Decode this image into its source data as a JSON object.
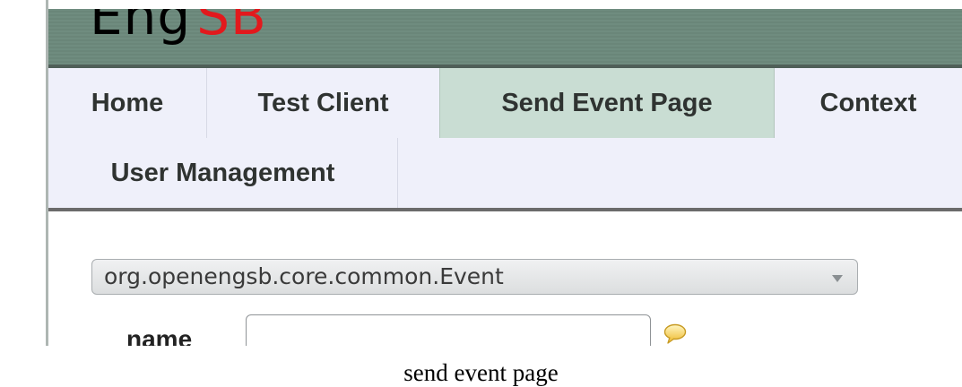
{
  "header": {
    "logo_primary": "Eng",
    "logo_accent": "SB",
    "colors": {
      "bar": "#6f8c7f",
      "logo_accent": "#e2191d"
    }
  },
  "nav": {
    "tabs": [
      {
        "label": "Home"
      },
      {
        "label": "Test Client"
      },
      {
        "label": "Send Event Page",
        "active": true
      },
      {
        "label": "Context"
      },
      {
        "label": "User Management"
      }
    ],
    "colors": {
      "background": "#eff0fa",
      "active_tab": "#c9ddd3"
    }
  },
  "form": {
    "event_type_select": {
      "selected": "org.openengsb.core.common.Event"
    },
    "fields": [
      {
        "label": "name",
        "value": "",
        "help_icon": "speech-bubble-icon"
      }
    ]
  },
  "caption": "send event page"
}
